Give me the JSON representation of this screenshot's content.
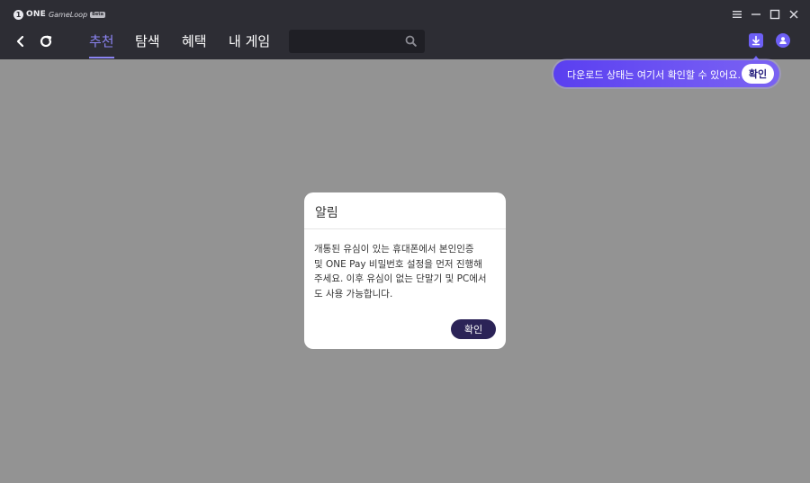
{
  "app": {
    "brand_mark": "1",
    "brand_name": "ONE",
    "brand_product": "GameLoop",
    "brand_badge": "Beta"
  },
  "nav": {
    "tabs": [
      {
        "label": "추천",
        "active": true
      },
      {
        "label": "탐색",
        "active": false
      },
      {
        "label": "혜택",
        "active": false
      },
      {
        "label": "내 게임",
        "active": false
      }
    ]
  },
  "search": {
    "value": "",
    "placeholder": ""
  },
  "download_tooltip": {
    "text": "다운로드 상태는 여기서 확인할 수 있어요.",
    "confirm_label": "확인"
  },
  "dialog": {
    "title": "알림",
    "body_lines": [
      "개통된 유심이 있는 휴대폰에서 본인인증",
      "및 ONE Pay 비밀번호 설정을 먼저 진행해",
      "주세요. 이후 유심이 없는 단말기 및 PC에서",
      "도 사용 가능합니다."
    ],
    "confirm_label": "확인"
  },
  "colors": {
    "titlebar_bg": "#2d2d34",
    "overlay_bg": "#939393",
    "accent": "#6d5ff5",
    "active_tab": "#8b84f2",
    "dialog_button": "#2b2357"
  },
  "icons": {
    "menu": "menu-icon",
    "minimize": "minimize-icon",
    "maximize": "maximize-icon",
    "close": "close-icon",
    "back": "back-arrow-icon",
    "refresh": "refresh-icon",
    "search": "search-icon",
    "download": "download-icon",
    "account": "user-icon"
  }
}
